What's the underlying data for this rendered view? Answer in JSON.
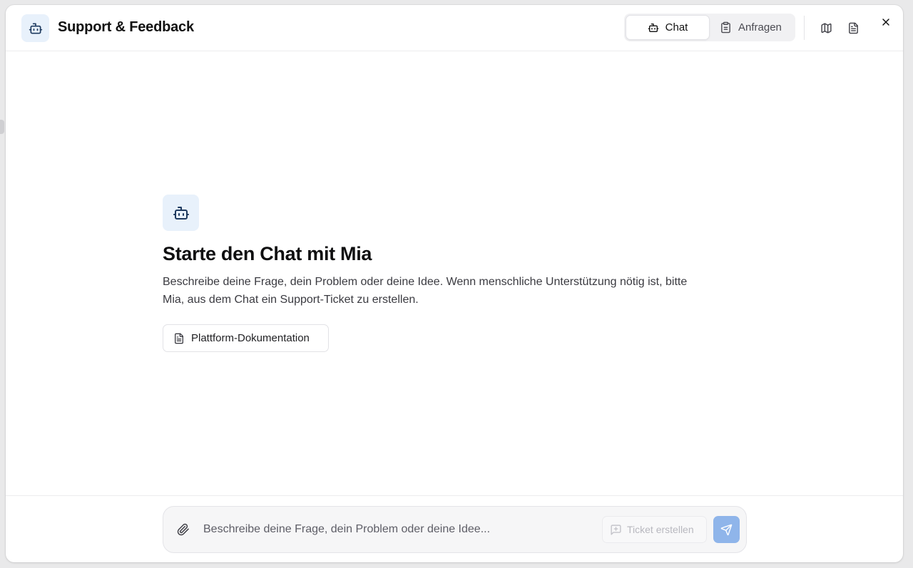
{
  "header": {
    "title": "Support & Feedback",
    "icon": "robot-icon",
    "tabs": [
      {
        "label": "Chat",
        "icon": "robot-icon",
        "active": true
      },
      {
        "label": "Anfragen",
        "icon": "clipboard-icon",
        "active": false
      }
    ],
    "actions": [
      "map-icon",
      "document-icon",
      "close-icon"
    ]
  },
  "welcome": {
    "icon": "robot-icon",
    "title": "Starte den Chat mit Mia",
    "description": "Beschreibe deine Frage, dein Problem oder deine Idee. Wenn menschliche Unterstützung nötig ist, bitte Mia, aus dem Chat ein Support-Ticket zu erstellen.",
    "doc_button": "Plattform-Dokumentation"
  },
  "composer": {
    "placeholder": "Beschreibe deine Frage, dein Problem oder deine Idee...",
    "ticket_button": "Ticket erstellen",
    "send_icon": "send-icon",
    "attach_icon": "paperclip-icon"
  },
  "colors": {
    "accent": "#2563eb",
    "accent_soft": "#e8f1fb",
    "send_disabled": "#8fb5ea",
    "icon_dark": "#1e3a5f"
  }
}
